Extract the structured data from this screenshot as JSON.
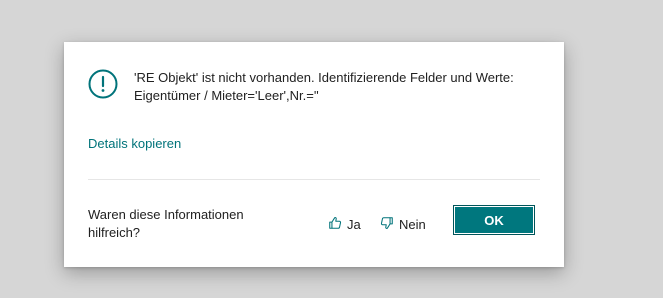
{
  "dialog": {
    "message_line1": "'RE Objekt' ist nicht vorhanden. Identifizierende Felder und Werte:",
    "message_line2": "Eigentümer / Mieter='Leer',Nr.=''",
    "details_link": "Details kopieren",
    "feedback_question_line1": "Waren diese Informationen",
    "feedback_question_line2": "hilfreich?",
    "yes_label": "Ja",
    "no_label": "Nein",
    "ok_label": "OK",
    "icon": "info-icon"
  },
  "colors": {
    "accent": "#00777e",
    "link": "#00737a",
    "backdrop": "#d6d6d6"
  }
}
